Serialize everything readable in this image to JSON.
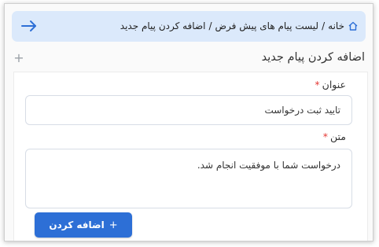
{
  "breadcrumb": {
    "home_label": "خانه",
    "separator": "/",
    "items": [
      "لیست پیام های پیش فرض",
      "اضافه کردن پیام جدید"
    ],
    "back_icon": "arrow-right-icon",
    "home_icon": "home-icon"
  },
  "section": {
    "title": "اضافه کردن پیام جدید",
    "toggle_icon": "plus-icon"
  },
  "form": {
    "title_label": "عنوان",
    "title_value": "تایید ثبت درخواست",
    "body_label": "متن",
    "body_value": "درخواست شما با موفقیت انجام شد.",
    "required_mark": "*"
  },
  "actions": {
    "add_label": "اضافه کردن",
    "add_icon": "+"
  },
  "colors": {
    "accent": "#2d6fd6",
    "breadcrumb_bg": "#dbe9fb",
    "required": "#e53935"
  }
}
